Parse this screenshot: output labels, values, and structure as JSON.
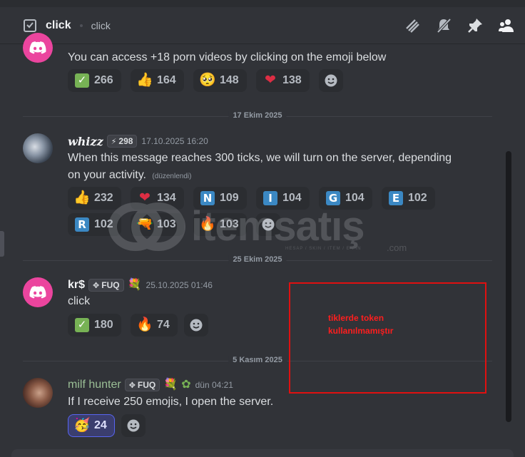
{
  "header": {
    "channel_name": "click",
    "topic": "click",
    "icons": [
      "threads-icon",
      "mute-notifications-icon",
      "pinned-messages-icon",
      "member-list-icon"
    ]
  },
  "messages": [
    {
      "author": "",
      "text": "You can access +18 porn videos by clicking on the emoji below",
      "reactions": [
        {
          "emoji": "check-mark-box",
          "count": "266"
        },
        {
          "emoji": "thumbs-up",
          "count": "164"
        },
        {
          "emoji": "pleading-face",
          "count": "148"
        },
        {
          "emoji": "red-heart",
          "count": "138"
        }
      ]
    },
    {
      "author": "whizz",
      "tag": "298",
      "timestamp": "17.10.2025 16:20",
      "text_line1": "When this message reaches 300 ticks, we will turn on the server, depending",
      "text_line2": "on your activity.",
      "edited": "(düzenlendi)",
      "reactions": [
        {
          "emoji": "thumbs-up",
          "count": "232"
        },
        {
          "emoji": "red-heart",
          "count": "134"
        },
        {
          "emoji": "N",
          "count": "109"
        },
        {
          "emoji": "I",
          "count": "104"
        },
        {
          "emoji": "G",
          "count": "104"
        },
        {
          "emoji": "E",
          "count": "102"
        },
        {
          "emoji": "R",
          "count": "102"
        },
        {
          "emoji": "water-pistol",
          "count": "103"
        },
        {
          "emoji": "fire",
          "count": "103"
        }
      ]
    },
    {
      "author": "kr$",
      "tag": "FUQ",
      "timestamp": "25.10.2025 01:46",
      "text": "click",
      "reactions": [
        {
          "emoji": "check-mark-box",
          "count": "180"
        },
        {
          "emoji": "fire",
          "count": "74"
        }
      ]
    },
    {
      "author": "milf hunter",
      "tag": "FUQ",
      "timestamp": "dün 04:21",
      "text": "If I receive 250 emojis, I open the server.",
      "reactions": [
        {
          "emoji": "partying-face",
          "count": "24",
          "active": true
        }
      ]
    }
  ],
  "dividers": [
    "17 Ekim 2025",
    "25 Ekim 2025",
    "5 Kasım 2025"
  ],
  "watermark": {
    "brand": "itemsatış",
    "tagline": "HESAP / SKIN / ITEM / E-PIN",
    "suffix": ".com"
  },
  "annotation": {
    "line1": "tiklerde token",
    "line2": "kullanılmamıştır",
    "color": "#e01010"
  },
  "colors": {
    "background": "#313338",
    "discord_pink": "#eb459e",
    "blurple": "#5865f2"
  }
}
